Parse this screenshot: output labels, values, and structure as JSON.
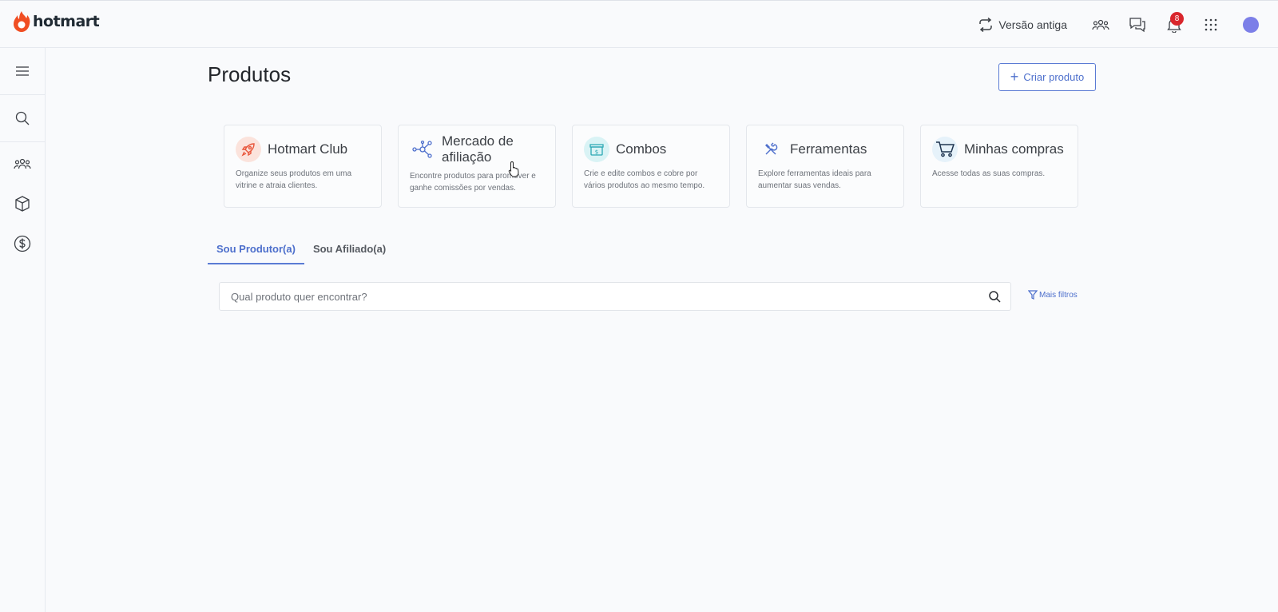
{
  "header": {
    "brand": "hotmart",
    "old_version_label": "Versão antiga",
    "notifications_count": "8",
    "brand_color": "#f04e23",
    "accent_color": "#5b7bd4"
  },
  "sidebar": {
    "items": [
      {
        "icon": "menu-icon"
      },
      {
        "icon": "search-icon"
      },
      {
        "icon": "users-icon"
      },
      {
        "icon": "box-icon"
      },
      {
        "icon": "dollar-icon"
      }
    ]
  },
  "page": {
    "title": "Produtos",
    "create_button": "Criar produto"
  },
  "cards": [
    {
      "title": "Hotmart Club",
      "description": "Organize seus produtos em uma vitrine e atraia clientes.",
      "icon": "rocket-icon"
    },
    {
      "title": "Mercado de afiliação",
      "description": "Encontre produtos para promover e ganhe comissões por vendas.",
      "icon": "network-icon"
    },
    {
      "title": "Combos",
      "description": "Crie e edite combos e cobre por vários produtos ao mesmo tempo.",
      "icon": "gift-box-icon"
    },
    {
      "title": "Ferramentas",
      "description": "Explore ferramentas ideais para aumentar suas vendas.",
      "icon": "tools-icon"
    },
    {
      "title": "Minhas compras",
      "description": "Acesse todas as suas compras.",
      "icon": "cart-icon"
    }
  ],
  "tabs": [
    {
      "label": "Sou Produtor(a)",
      "active": true
    },
    {
      "label": "Sou Afiliado(a)",
      "active": false
    }
  ],
  "search": {
    "placeholder": "Qual produto quer encontrar?",
    "value": ""
  },
  "filters_label": "Mais filtros"
}
